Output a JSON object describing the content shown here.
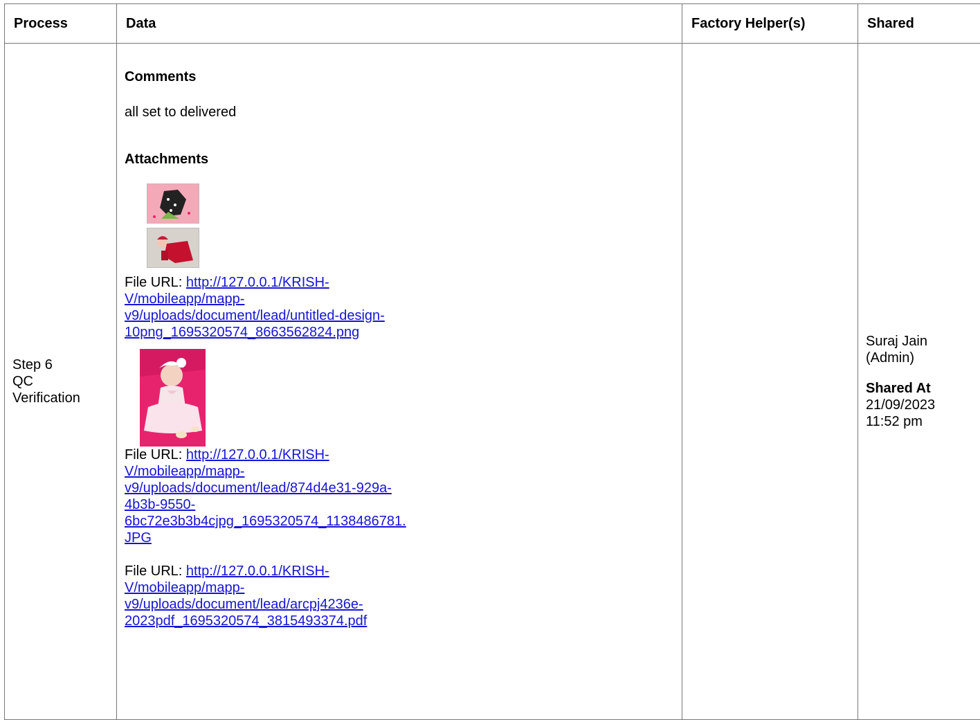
{
  "headers": {
    "process": "Process",
    "data": "Data",
    "helpers": "Factory Helper(s)",
    "shared": "Shared"
  },
  "row": {
    "process_line1": "Step 6",
    "process_line2": "QC",
    "process_line3": "Verification",
    "comments_heading": "Comments",
    "comments_text": "all set to delivered",
    "attachments_heading": "Attachments",
    "file_label": "File URL:",
    "files": [
      {
        "url_lines": [
          "http://127.0.0.1/KRISH-",
          "V/mobileapp/mapp-",
          "v9/uploads/document/lead/untitled-design-",
          "10png_1695320574_8663562824.png"
        ]
      },
      {
        "url_lines": [
          "http://127.0.0.1/KRISH-",
          "V/mobileapp/mapp-",
          "v9/uploads/document/lead/874d4e31-929a-",
          "4b3b-9550-",
          "6bc72e3b3b4cjpg_1695320574_1138486781.",
          "JPG"
        ]
      },
      {
        "url_lines": [
          "http://127.0.0.1/KRISH-",
          "V/mobileapp/mapp-",
          "v9/uploads/document/lead/arcpj4236e-",
          "2023pdf_1695320574_3815493374.pdf"
        ]
      }
    ],
    "helpers": "",
    "shared_by_line1": "Suraj Jain",
    "shared_by_line2": "(Admin)",
    "shared_at_label": "Shared At",
    "shared_at_date": "21/09/2023",
    "shared_at_time": "11:52 pm"
  }
}
